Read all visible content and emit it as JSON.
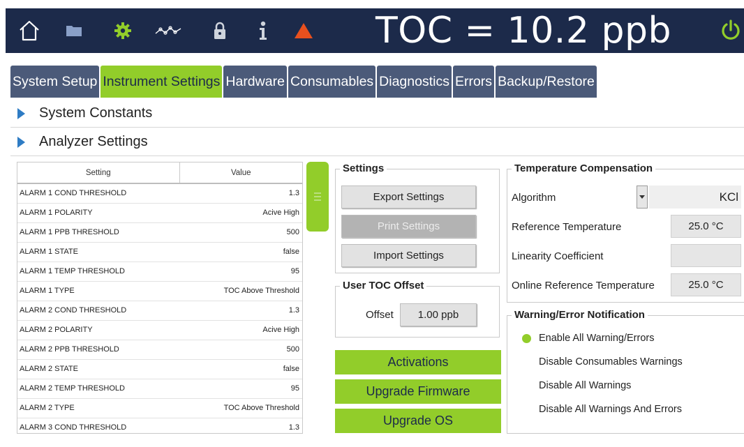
{
  "header": {
    "title": "TOC = 10.2 ppb",
    "icons": [
      "home-icon",
      "folder-icon",
      "gear-icon",
      "trend-icon",
      "lock-icon",
      "info-icon",
      "warning-icon",
      "power-icon"
    ],
    "colors": {
      "bar": "#1c2a4a",
      "accent": "#92cd2a",
      "warning": "#e8501e",
      "folder": "#8aa0c8"
    }
  },
  "tabs": [
    {
      "label": "System Setup",
      "active": false
    },
    {
      "label": "Instrument Settings",
      "active": true
    },
    {
      "label": "Hardware",
      "active": false
    },
    {
      "label": "Consumables",
      "active": false
    },
    {
      "label": "Diagnostics",
      "active": false
    },
    {
      "label": "Errors",
      "active": false
    },
    {
      "label": "Backup/Restore",
      "active": false
    }
  ],
  "sections": {
    "system_constants": "System Constants",
    "analyzer_settings": "Analyzer Settings"
  },
  "settings_table": {
    "columns": [
      "Setting",
      "Value"
    ],
    "rows": [
      [
        "ALARM 1 COND THRESHOLD",
        "1.3"
      ],
      [
        "ALARM 1 POLARITY",
        "Acive High"
      ],
      [
        "ALARM 1 PPB THRESHOLD",
        "500"
      ],
      [
        "ALARM 1 STATE",
        "false"
      ],
      [
        "ALARM 1 TEMP THRESHOLD",
        "95"
      ],
      [
        "ALARM 1 TYPE",
        "TOC Above Threshold"
      ],
      [
        "ALARM 2 COND THRESHOLD",
        "1.3"
      ],
      [
        "ALARM 2 POLARITY",
        "Acive High"
      ],
      [
        "ALARM 2 PPB THRESHOLD",
        "500"
      ],
      [
        "ALARM 2 STATE",
        "false"
      ],
      [
        "ALARM 2 TEMP THRESHOLD",
        "95"
      ],
      [
        "ALARM 2 TYPE",
        "TOC Above Threshold"
      ],
      [
        "ALARM 3 COND THRESHOLD",
        "1.3"
      ]
    ]
  },
  "settings_group": {
    "legend": "Settings",
    "export_label": "Export Settings",
    "print_label": "Print Settings",
    "import_label": "Import Settings"
  },
  "toc_offset": {
    "legend": "User TOC Offset",
    "offset_label": "Offset",
    "offset_value": "1.00 ppb"
  },
  "actions": {
    "activations": "Activations",
    "upgrade_firmware": "Upgrade Firmware",
    "upgrade_os": "Upgrade OS"
  },
  "temp_comp": {
    "legend": "Temperature Compensation",
    "algorithm_label": "Algorithm",
    "algorithm_value": "KCl",
    "ref_temp_label": "Reference Temperature",
    "ref_temp_value": "25.0 °C",
    "linearity_label": "Linearity Coefficient",
    "linearity_value": "",
    "online_ref_label": "Online Reference Temperature",
    "online_ref_value": "25.0 °C"
  },
  "notifications": {
    "legend": "Warning/Error Notification",
    "options": [
      {
        "label": "Enable All Warning/Errors",
        "selected": true
      },
      {
        "label": "Disable Consumables Warnings",
        "selected": false
      },
      {
        "label": "Disable All Warnings",
        "selected": false
      },
      {
        "label": "Disable All Warnings And Errors",
        "selected": false
      }
    ]
  }
}
